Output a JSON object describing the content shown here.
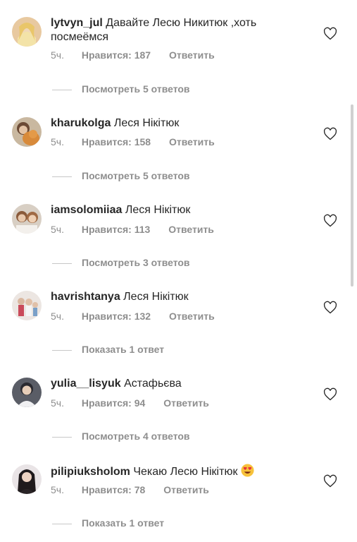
{
  "comments": [
    {
      "username": "lytvyn_jul",
      "text": "Давайте Лесю Никитюк ,хоть посмеёмся",
      "time": "5ч.",
      "likes": "Нравится: 187",
      "reply": "Ответить",
      "replies_link": "Посмотреть 5 ответов",
      "avatar": "avatar-blonde-woman"
    },
    {
      "username": "kharukolga",
      "text": "Леся Нікітюк",
      "time": "5ч.",
      "likes": "Нравится: 158",
      "reply": "Ответить",
      "replies_link": "Посмотреть 5 ответов",
      "avatar": "avatar-woman-with-cat"
    },
    {
      "username": "iamsolomiiaa",
      "text": "Леся Нікітюк",
      "time": "5ч.",
      "likes": "Нравится: 113",
      "reply": "Ответить",
      "replies_link": "Посмотреть 3 ответов",
      "avatar": "avatar-two-girls"
    },
    {
      "username": "havrishtanya",
      "text": "Леся Нікітюк",
      "time": "5ч.",
      "likes": "Нравится: 132",
      "reply": "Ответить",
      "replies_link": "Показать 1 ответ",
      "avatar": "avatar-family"
    },
    {
      "username": "yulia__lisyuk",
      "text": "Астафьєва",
      "time": "5ч.",
      "likes": "Нравится: 94",
      "reply": "Ответить",
      "replies_link": "Посмотреть 4 ответов",
      "avatar": "avatar-woman-dark"
    },
    {
      "username": "pilipiuksholom",
      "text": "Чекаю Лесю Нікітюк",
      "time": "5ч.",
      "likes": "Нравится: 78",
      "reply": "Ответить",
      "replies_link": "Показать 1 ответ",
      "avatar": "avatar-woman-brunette",
      "emoji": "heart-eyes-emoji"
    }
  ],
  "icons": {
    "like": "heart-outline-icon"
  },
  "colors": {
    "text": "#262626",
    "secondary": "#8e8e8e",
    "divider": "#c7c7c7"
  }
}
